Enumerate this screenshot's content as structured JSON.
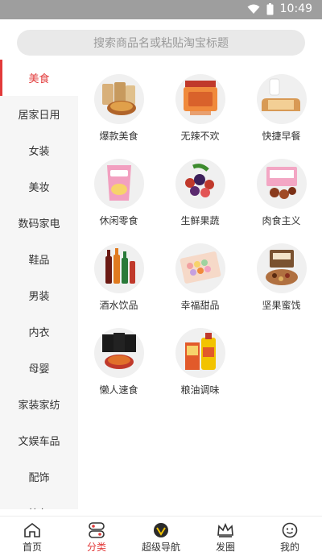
{
  "status_bar": {
    "time": "10:49"
  },
  "search": {
    "placeholder": "搜索商品名或粘贴淘宝标题"
  },
  "categories": [
    {
      "label": "美食",
      "active": true
    },
    {
      "label": "居家日用"
    },
    {
      "label": "女装"
    },
    {
      "label": "美妆"
    },
    {
      "label": "数码家电"
    },
    {
      "label": "鞋品"
    },
    {
      "label": "男装"
    },
    {
      "label": "内衣"
    },
    {
      "label": "母婴"
    },
    {
      "label": "家装家纺"
    },
    {
      "label": "文娱车品"
    },
    {
      "label": "配饰"
    },
    {
      "label": "箱包"
    }
  ],
  "subcategories": [
    {
      "label": "爆款美食",
      "icon": "snack-bags-icon"
    },
    {
      "label": "无辣不欢",
      "icon": "spicy-jerky-icon"
    },
    {
      "label": "快捷早餐",
      "icon": "bread-milk-icon"
    },
    {
      "label": "休闲零食",
      "icon": "chips-bag-icon"
    },
    {
      "label": "生鲜果蔬",
      "icon": "berries-icon"
    },
    {
      "label": "肉食主义",
      "icon": "meat-box-icon"
    },
    {
      "label": "酒水饮品",
      "icon": "bottles-icon"
    },
    {
      "label": "幸福甜品",
      "icon": "macaron-box-icon"
    },
    {
      "label": "坚果蜜饯",
      "icon": "nuts-box-icon"
    },
    {
      "label": "懒人速食",
      "icon": "instant-noodles-icon"
    },
    {
      "label": "粮油调味",
      "icon": "oil-rice-icon"
    }
  ],
  "tabs": [
    {
      "label": "首页",
      "icon": "home-icon"
    },
    {
      "label": "分类",
      "icon": "category-icon",
      "active": true
    },
    {
      "label": "超级导航",
      "icon": "super-nav-icon"
    },
    {
      "label": "发圈",
      "icon": "crown-icon"
    },
    {
      "label": "我的",
      "icon": "profile-icon"
    }
  ],
  "colors": {
    "accent": "#e23a3a",
    "status_bar": "#9e9e9e",
    "sidebar_bg": "#f6f6f6"
  }
}
